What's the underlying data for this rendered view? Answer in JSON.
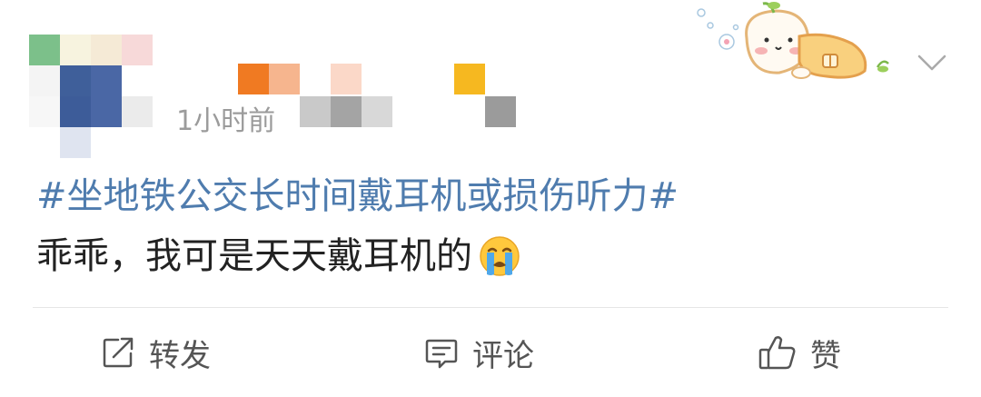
{
  "post": {
    "time": "1小时前",
    "hashtag": "#坐地铁公交长时间戴耳机或损伤听力#",
    "text": "乖乖，我可是天天戴耳机的"
  },
  "actions": {
    "repost": "转发",
    "comment": "评论",
    "like": "赞"
  },
  "colors": {
    "hashtag": "#4f7cae",
    "meta_text": "#9b9b9b",
    "body_text": "#222222",
    "action_text": "#555555",
    "divider": "#e6e6e6"
  },
  "icons": {
    "menu": "chevron-down-icon",
    "repost": "share-icon",
    "comment": "comment-icon",
    "like": "thumbs-up-icon",
    "emoji": "crying-face-emoji"
  }
}
